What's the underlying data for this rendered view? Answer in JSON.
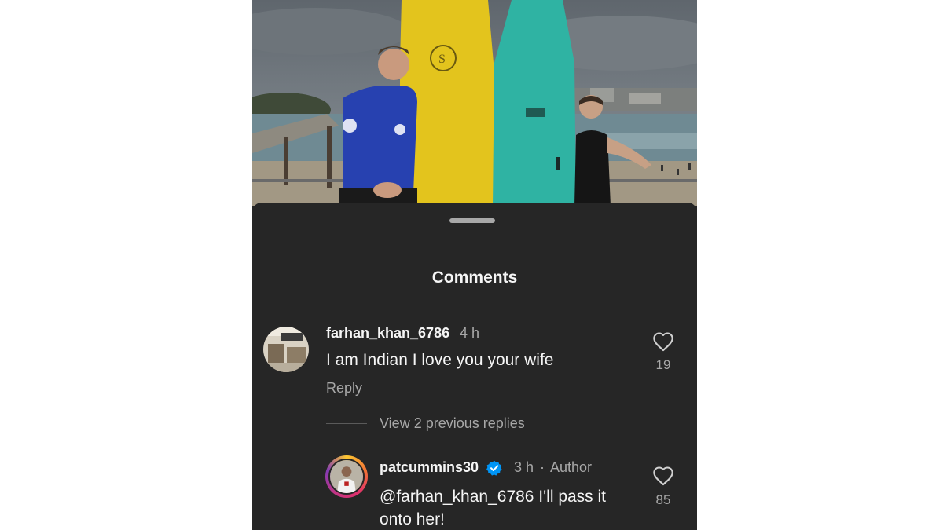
{
  "sheet": {
    "title": "Comments"
  },
  "comment": {
    "username": "farhan_khan_6786",
    "time": "4 h",
    "text": "I am Indian I love you your wife",
    "reply_label": "Reply",
    "likes": "19"
  },
  "view_replies": "View 2 previous replies",
  "reply": {
    "username": "patcummins30",
    "time": "3 h",
    "separator": "·",
    "role": "Author",
    "text": "@farhan_khan_6786 I'll pass it onto her!",
    "likes": "85"
  },
  "colors": {
    "sheet_bg": "#262626",
    "primary_text": "#f5f5f5",
    "secondary_text": "#a8a8a8",
    "verified_badge": "#0095f6"
  },
  "icons": {
    "like": "heart-outline-icon",
    "verified": "verified-badge-icon"
  }
}
